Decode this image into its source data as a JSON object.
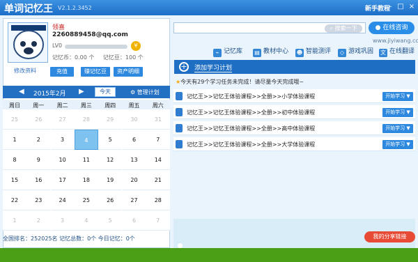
{
  "window": {
    "title": "单词记忆王",
    "version": "V2.1.2.3452",
    "guide": "新手教程"
  },
  "profile": {
    "name": "领喜",
    "email": "2260889458@qq.com",
    "level": "LV0",
    "level_fill": 0.0,
    "coins_label": "记忆币：0.00 个",
    "beans_label": "记忆豆：100 个",
    "edit": "修改资料"
  },
  "buttons": {
    "recharge": "充值",
    "earn": "赚记忆豆",
    "assets": "资产明细",
    "today": "今天",
    "plan": "管理计划",
    "search": "搜索一下",
    "consult": "在线咨询",
    "add_plan": "添加学习计划",
    "share": "我的分享链接"
  },
  "calendar": {
    "month": "2015年2月",
    "weekdays": [
      "周日",
      "周一",
      "周二",
      "周三",
      "周四",
      "周五",
      "周六"
    ],
    "weeks": [
      [
        "25",
        "26",
        "27",
        "28",
        "29",
        "30",
        "31"
      ],
      [
        "1",
        "2",
        "3",
        "4",
        "5",
        "6",
        "7"
      ],
      [
        "8",
        "9",
        "10",
        "11",
        "12",
        "13",
        "14"
      ],
      [
        "15",
        "16",
        "17",
        "18",
        "19",
        "20",
        "21"
      ],
      [
        "22",
        "23",
        "24",
        "25",
        "26",
        "27",
        "28"
      ],
      [
        "1",
        "2",
        "3",
        "4",
        "5",
        "6",
        "7"
      ]
    ],
    "status": "全国排名：252025名   记忆总数：0个   今日记忆：0个"
  },
  "top": {
    "site": "www.jiyiwang.cc",
    "nav": [
      "记忆库",
      "教材中心",
      "智能测评",
      "游戏巩固",
      "在线翻译"
    ]
  },
  "tip": "今天有29个学习任务未完成！请尽量今天完成哦~",
  "courses": [
    {
      "title": "记忆王>>记忆王体验课程>>全册>>小学体验课程",
      "action": "开始学习"
    },
    {
      "title": "记忆王>>记忆王体验课程>>全册>>初中体验课程",
      "action": "开始学习"
    },
    {
      "title": "记忆王>>记忆王体验课程>>全册>>高中体验课程",
      "action": "开始学习"
    },
    {
      "title": "记忆王>>记忆王体验课程>>全册>>大学体验课程",
      "action": "开始学习"
    }
  ]
}
